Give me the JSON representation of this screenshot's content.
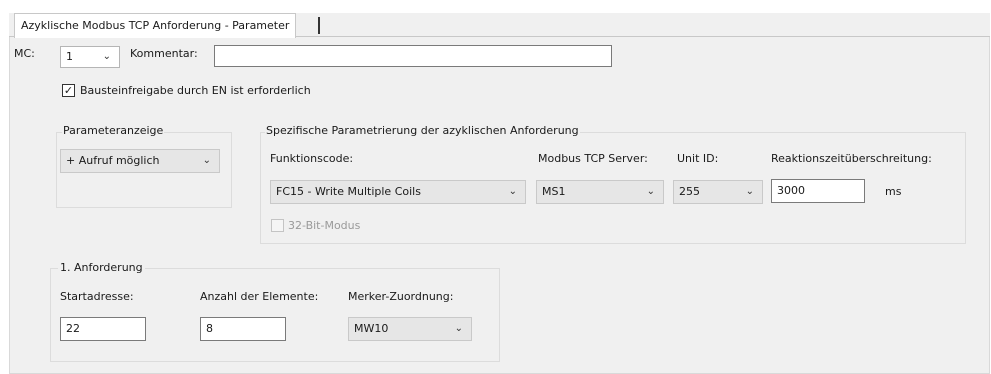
{
  "tab": {
    "label": "Azyklische Modbus TCP Anforderung - Parameter"
  },
  "header": {
    "mc_label": "MC:",
    "mc_value": "1",
    "comment_label": "Kommentar:",
    "comment_value": ""
  },
  "enable": {
    "label": "Bausteinfreigabe durch EN ist erforderlich",
    "checked": true
  },
  "param_display": {
    "title": "Parameteranzeige",
    "value": "+ Aufruf möglich"
  },
  "specific": {
    "title": "Spezifische Parametrierung der azyklischen Anforderung",
    "function_code_label": "Funktionscode:",
    "function_code_value": "FC15 - Write Multiple Coils",
    "server_label": "Modbus TCP Server:",
    "server_value": "MS1",
    "unit_id_label": "Unit ID:",
    "unit_id_value": "255",
    "timeout_label": "Reaktionszeitüberschreitung:",
    "timeout_value": "3000",
    "timeout_unit": "ms",
    "bit32_label": "32-Bit-Modus",
    "bit32_checked": false
  },
  "request": {
    "title": "1. Anforderung",
    "start_label": "Startadresse:",
    "start_value": "22",
    "count_label": "Anzahl der Elemente:",
    "count_value": "8",
    "marker_label": "Merker-Zuordnung:",
    "marker_value": "MW10"
  },
  "icons": {
    "dropdown": "chevron-down-icon",
    "check": "checkmark-icon"
  }
}
